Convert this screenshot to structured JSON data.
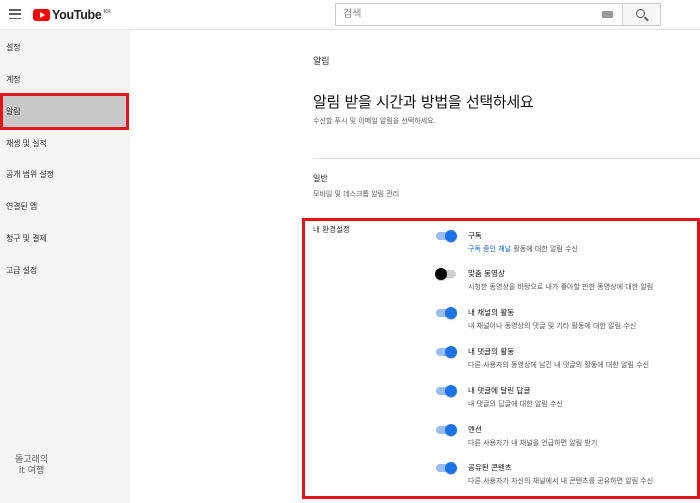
{
  "header": {
    "menu_icon": "hamburger-menu-icon",
    "logo_text": "YouTube",
    "logo_region": "KR",
    "search_placeholder": "검색",
    "keyboard_icon": "keyboard-icon",
    "search_icon": "magnifier-icon"
  },
  "sidebar": {
    "items": [
      {
        "label": "설정"
      },
      {
        "label": "계정"
      },
      {
        "label": "알림"
      },
      {
        "label": "재생 및 실적"
      },
      {
        "label": "공개 범위 설정"
      },
      {
        "label": "연결된 앱"
      },
      {
        "label": "청구 및 결제"
      },
      {
        "label": "고급 설정"
      }
    ],
    "active_index": 2
  },
  "watermark": {
    "line1": "돌고래의",
    "line2": "it 여행"
  },
  "main": {
    "label": "알림",
    "title": "알림 받을 시간과 방법을 선택하세요",
    "description": "수신할 푸시 및 이메일 알림을 선택하세요.",
    "section_title": "일반",
    "section_description": "모바일 및 데스크톱 알림 관리",
    "preferences_label": "내 환경설정"
  },
  "preferences": [
    {
      "title": "구독",
      "desc_link": "구독 중인 채널",
      "desc": " 활동에 대한 알림 수신",
      "on": true
    },
    {
      "title": "맞춤 동영상",
      "desc_link": "",
      "desc": "시청한 동영상을 바탕으로 내가 좋아할 만한 동영상에 대한 알림",
      "on": false
    },
    {
      "title": "내 채널의 활동",
      "desc_link": "",
      "desc": "내 채널이나 동영상의 댓글 및 기타 활동에 대한 알림 수신",
      "on": true
    },
    {
      "title": "내 댓글의 활동",
      "desc_link": "",
      "desc": "다른 사용자의 동영상에 남긴 내 댓글의 활동에 대한 알림 수신",
      "on": true
    },
    {
      "title": "내 댓글에 달린 답글",
      "desc_link": "",
      "desc": "내 댓글의 답글에 대한 알림 수신",
      "on": true
    },
    {
      "title": "멘션",
      "desc_link": "",
      "desc": "다른 사용자가 내 채널을 언급하면 알림 받기",
      "on": true
    },
    {
      "title": "공유된 콘텐츠",
      "desc_link": "",
      "desc": "다른 사용자가 자신의 채널에서 내 콘텐츠를 공유하면 알림 수신",
      "on": true
    }
  ],
  "colors": {
    "highlight_box": "#e0161b",
    "toggle_on": "#1a73e8",
    "link": "#1565c0"
  }
}
